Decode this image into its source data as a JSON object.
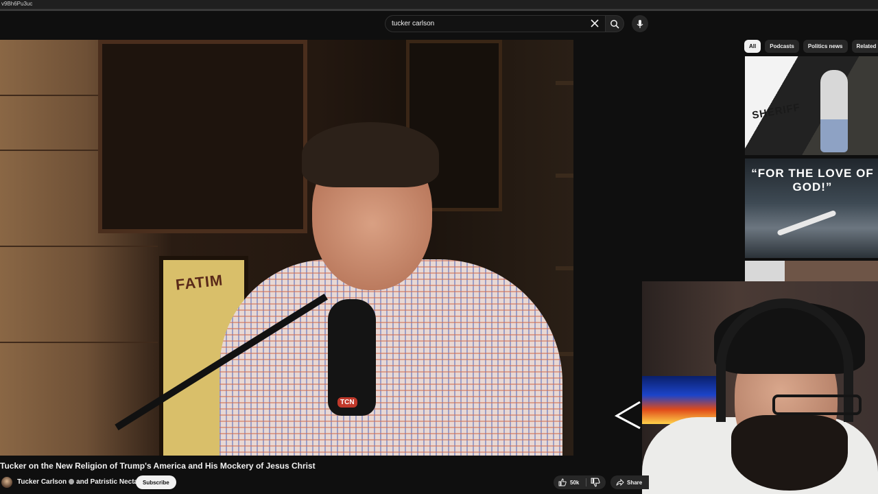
{
  "browser": {
    "url_fragment": "v9Bh6Pu3uc"
  },
  "search": {
    "query": "tucker carlson"
  },
  "video": {
    "title": "Tucker on the New Religion of Trump's America and His Mockery of Jesus Christ",
    "channel": "Tucker Carlson",
    "collab": "and Patristic Nectar",
    "subscribe_label": "Subscribe",
    "likes": "50k",
    "share_label": "Share",
    "mic_logo": "TCN",
    "poster_text": "FATIM"
  },
  "sidebar": {
    "chips": [
      "All",
      "Podcasts",
      "Politics news",
      "Related"
    ],
    "active_chip": "All",
    "thumbnails": [
      {
        "overlay_text": "SHERIFF"
      },
      {
        "overlay_text": "“FOR THE LOVE OF GOD!”"
      },
      {
        "overlay_text": ""
      }
    ]
  },
  "colors": {
    "background": "#0f0f0f",
    "chip_active": "#f1f1f1",
    "chip": "#272727"
  }
}
